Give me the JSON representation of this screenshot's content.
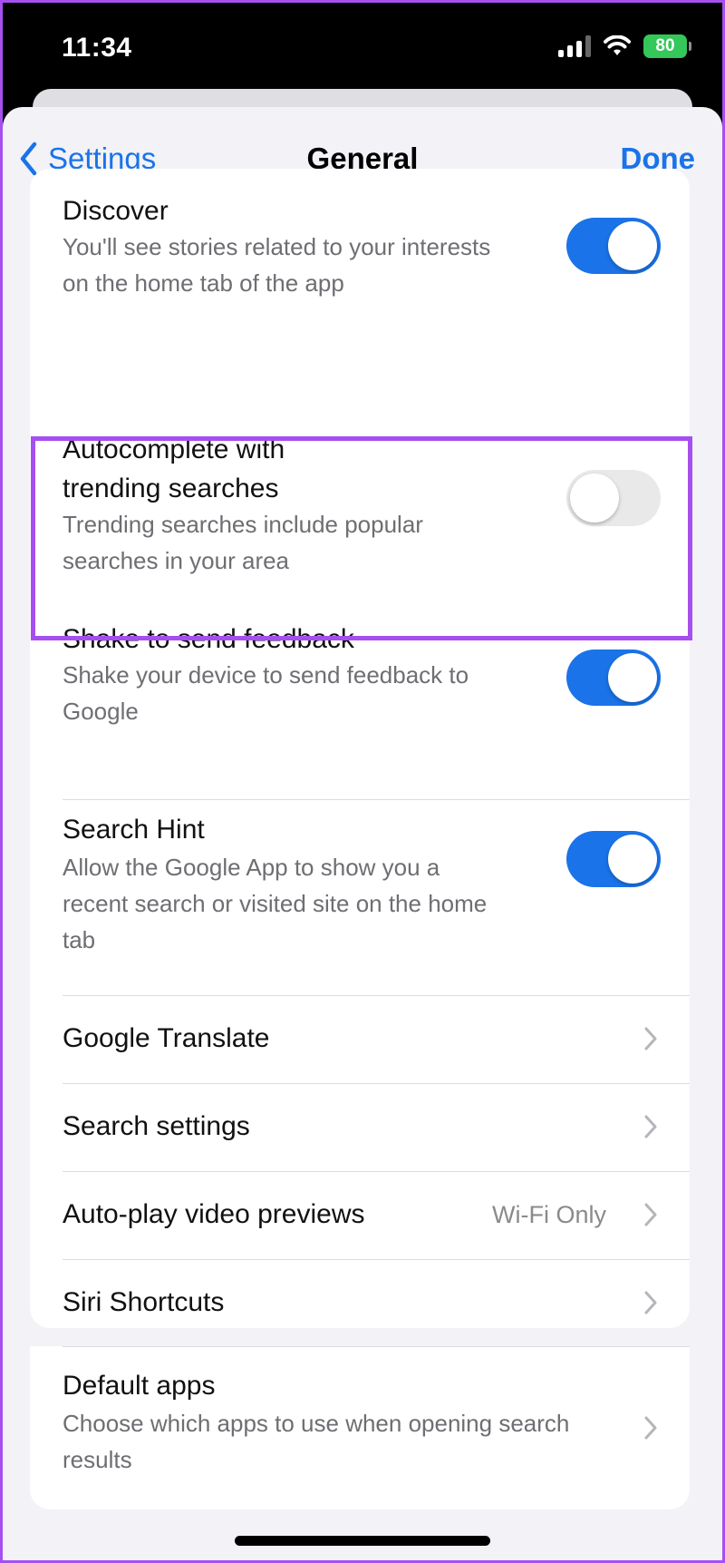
{
  "status_bar": {
    "time": "11:34",
    "battery": "80"
  },
  "nav": {
    "back_label": "Settings",
    "title": "General",
    "done_label": "Done"
  },
  "settings": {
    "discover": {
      "title": "Discover",
      "subtitle": "You'll see stories related to your interests on the home tab of the app",
      "enabled": true
    },
    "autocomplete": {
      "title": "Autocomplete with trending searches",
      "subtitle": "Trending searches include popular searches in your area",
      "enabled": false
    },
    "shake": {
      "title": "Shake to send feedback",
      "subtitle": "Shake your device to send feedback to Google",
      "enabled": true
    },
    "search_hint": {
      "title": "Search Hint",
      "subtitle": "Allow the Google App to show you a recent search or visited site on the home tab",
      "enabled": true
    },
    "google_translate": {
      "title": "Google Translate"
    },
    "search_settings": {
      "title": "Search settings"
    },
    "autoplay": {
      "title": "Auto-play video previews",
      "value": "Wi-Fi Only"
    },
    "siri": {
      "title": "Siri Shortcuts"
    },
    "default_apps": {
      "title": "Default apps",
      "subtitle": "Choose which apps to use when opening search results"
    }
  },
  "colors": {
    "accent": "#1a73e8",
    "highlight": "#a64ff0",
    "toggle_off": "#e9e9ea",
    "background": "#f2f2f7"
  }
}
